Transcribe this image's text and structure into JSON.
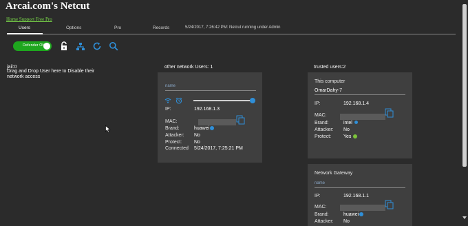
{
  "app": {
    "title": "Arcai.com's Netcut",
    "header_link": "Home Support Free Pro"
  },
  "tabs": [
    {
      "label": "Users"
    },
    {
      "label": "Options"
    },
    {
      "label": "Pro"
    },
    {
      "label": "Records"
    }
  ],
  "status_text": "5/24/2017, 7:26:42 PM: Netcut running under Admin",
  "toolbar": {
    "defender_label": "Defender ON",
    "icons": [
      "lock-icon",
      "network-icon",
      "refresh-icon",
      "search-icon"
    ]
  },
  "jail": {
    "header": "jail:0",
    "description": "Drag and Drop User here to Disable their network access"
  },
  "other_users": {
    "header": "other network Users: 1",
    "card": {
      "name_placeholder": "name",
      "slider_level": 1.0,
      "ip_label": "IP:",
      "ip": "192.168.1.3",
      "mac_label": "MAC:",
      "brand_label": "Brand:",
      "brand": "huawei",
      "attacker_label": "Attacker:",
      "attacker": "No",
      "protect_label": "Protect:",
      "protect": "No",
      "connected_label": "Connected",
      "connected": "5/24/2017, 7:25:21 PM"
    }
  },
  "trusted_users": {
    "header": "trusted users:2",
    "cards": [
      {
        "title": "This computer",
        "name": "OmarDahy-7",
        "ip_label": "IP:",
        "ip": "192.168.1.4",
        "mac_label": "MAC:",
        "brand_label": "Brand:",
        "brand": "intel",
        "attacker_label": "Attacker:",
        "attacker": "No",
        "protect_label": "Protect:",
        "protect": "Yes"
      },
      {
        "title": "Network Gateway",
        "name_placeholder": "name",
        "ip_label": "IP:",
        "ip": "192.168.1.1",
        "mac_label": "MAC:",
        "brand_label": "Brand:",
        "brand": "huawei",
        "attacker_label": "Attacker:",
        "attacker": "No"
      }
    ]
  },
  "colors": {
    "background": "#2b2b2b",
    "card": "#3f3f3f",
    "accent_blue": "#2f8fd8",
    "toggle_green": "#1ea61e",
    "link_green": "#7cdc4a"
  }
}
